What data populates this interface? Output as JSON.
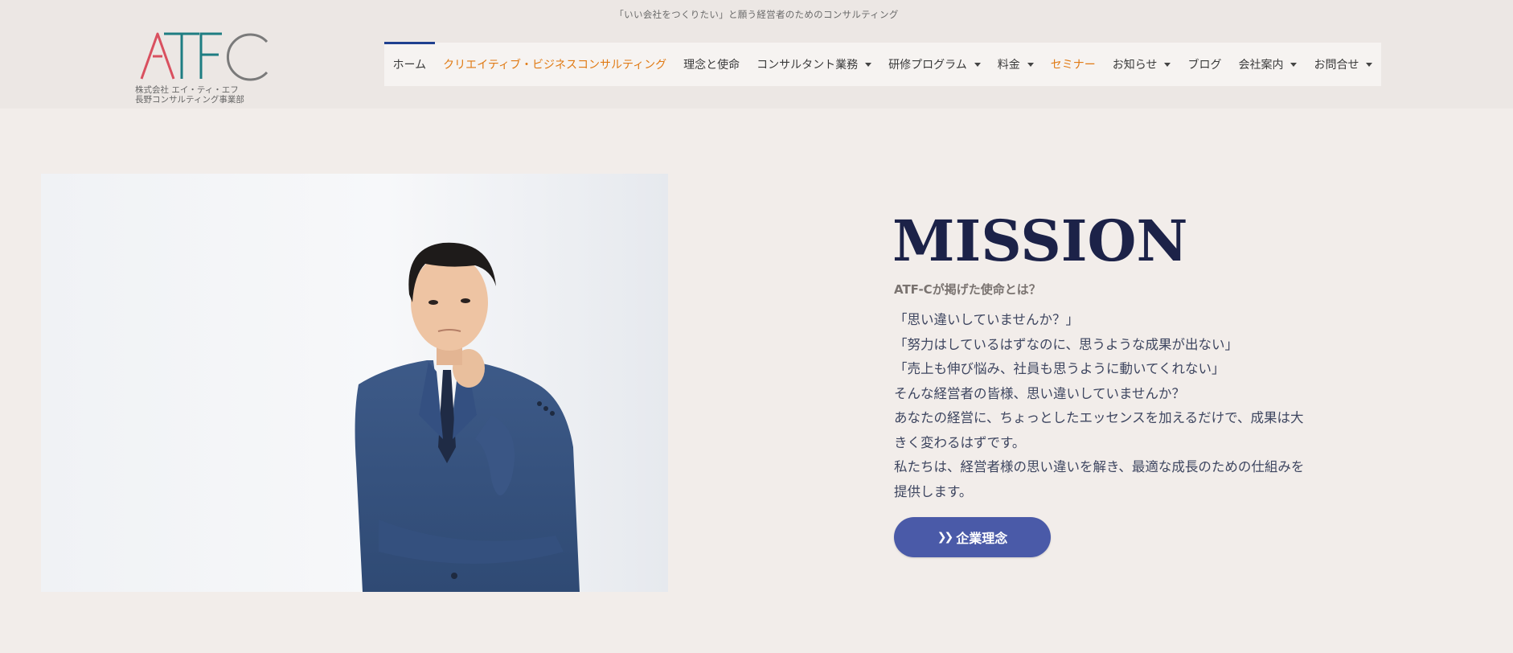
{
  "header": {
    "tagline": "「いい会社をつくりたい」と願う経営者のためのコンサルティング",
    "logo": {
      "text": "ATFC",
      "sub_line1": "株式会社 エイ・ティ・エフ",
      "sub_line2": "長野コンサルティング事業部"
    }
  },
  "nav": {
    "items": [
      {
        "label": "ホーム",
        "active": true
      },
      {
        "label": "クリエイティブ・ビジネスコンサルティング",
        "highlight": true
      },
      {
        "label": "理念と使命"
      },
      {
        "label": "コンサルタント業務",
        "dropdown": true
      },
      {
        "label": "研修プログラム",
        "dropdown": true
      },
      {
        "label": "料金",
        "dropdown": true
      },
      {
        "label": "セミナー",
        "highlight": true
      },
      {
        "label": "お知らせ",
        "dropdown": true
      },
      {
        "label": "ブログ"
      },
      {
        "label": "会社案内",
        "dropdown": true
      },
      {
        "label": "お問合せ",
        "dropdown": true
      }
    ]
  },
  "mission": {
    "title": "MISSION",
    "subtitle": "ATF-Cが掲げた使命とは？",
    "lines": [
      "「思い違いしていませんか？」",
      "「努力はしているはずなのに、思うような成果が出ない」",
      "「売上も伸び悩み、社員も思うように動いてくれない」",
      "そんな経営者の皆様、思い違いしていませんか？",
      "あなたの経営に、ちょっとしたエッセンスを加えるだけで、成果は大",
      "きく変わるはずです。",
      "私たちは、経営者様の思い違いを解き、最適な成長のための仕組みを",
      "提供します。"
    ],
    "button_label": "企業理念",
    "button_icon": "double-chevron-right-icon"
  },
  "colors": {
    "background": "#f2edea",
    "header_bg": "#ece7e4",
    "nav_bg": "#f6f3f1",
    "nav_active_bar": "#1f3f8f",
    "nav_highlight": "#e07a14",
    "title": "#1c2248",
    "button": "#4a5aa8",
    "logo_red": "#d9505f",
    "logo_teal": "#1e7d82",
    "logo_grey": "#7a7a7a"
  }
}
